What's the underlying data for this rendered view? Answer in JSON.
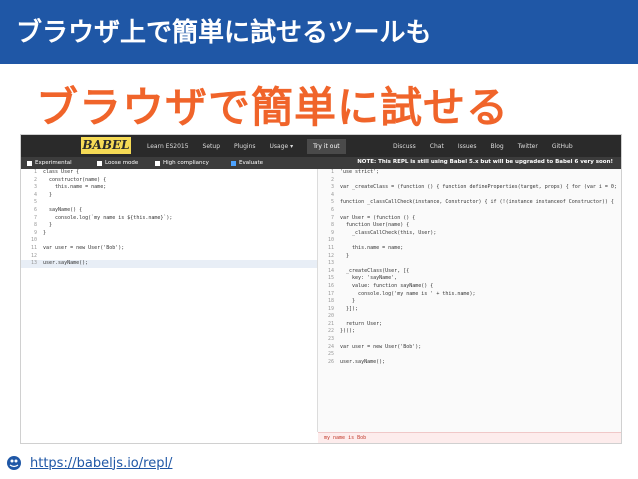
{
  "slide": {
    "title": "ブラウザ上で簡単に試せるツールも",
    "subtitle": "ブラウザで簡単に試せる",
    "link": "https://babeljs.io/repl/"
  },
  "colors": {
    "header_bg": "#1f57a6",
    "subtitle": "#f0642a",
    "babel_yellow": "#f5da55",
    "nav_dark": "#2a2a2a"
  },
  "babel": {
    "logo": "BABEL",
    "nav_left": [
      "Learn ES2015",
      "Setup",
      "Plugins",
      "Usage ▾",
      "Try it out"
    ],
    "nav_right": [
      "Discuss",
      "Chat",
      "Issues",
      "Blog",
      "Twitter",
      "GitHub"
    ],
    "options": [
      {
        "label": "Experimental",
        "checked": false
      },
      {
        "label": "Loose mode",
        "checked": false
      },
      {
        "label": "High compliancy",
        "checked": false
      },
      {
        "label": "Evaluate",
        "checked": true
      }
    ],
    "note": "NOTE: This REPL is still using Babel 5.x but will be upgraded to Babel 6 very soon!"
  },
  "editor": {
    "input": [
      {
        "n": "1",
        "code": "class User {"
      },
      {
        "n": "2",
        "code": "  constructor(name) {"
      },
      {
        "n": "3",
        "code": "    this.name = name;"
      },
      {
        "n": "4",
        "code": "  }"
      },
      {
        "n": "5",
        "code": ""
      },
      {
        "n": "6",
        "code": "  sayName() {"
      },
      {
        "n": "7",
        "code": "    console.log(`my name is ${this.name}`);"
      },
      {
        "n": "8",
        "code": "  }"
      },
      {
        "n": "9",
        "code": "}"
      },
      {
        "n": "10",
        "code": ""
      },
      {
        "n": "11",
        "code": "var user = new User('Bob');"
      },
      {
        "n": "12",
        "code": ""
      },
      {
        "n": "13",
        "code": "user.sayName();"
      }
    ],
    "output": [
      {
        "n": "1",
        "code": "'use strict';"
      },
      {
        "n": "2",
        "code": ""
      },
      {
        "n": "3",
        "code": "var _createClass = (function () { function defineProperties(target, props) { for (var i = 0;"
      },
      {
        "n": "4",
        "code": ""
      },
      {
        "n": "5",
        "code": "function _classCallCheck(instance, Constructor) { if (!(instance instanceof Constructor)) {"
      },
      {
        "n": "6",
        "code": ""
      },
      {
        "n": "7",
        "code": "var User = (function () {"
      },
      {
        "n": "8",
        "code": "  function User(name) {"
      },
      {
        "n": "9",
        "code": "    _classCallCheck(this, User);"
      },
      {
        "n": "10",
        "code": ""
      },
      {
        "n": "11",
        "code": "    this.name = name;"
      },
      {
        "n": "12",
        "code": "  }"
      },
      {
        "n": "13",
        "code": ""
      },
      {
        "n": "14",
        "code": "  _createClass(User, [{"
      },
      {
        "n": "15",
        "code": "    key: 'sayName',"
      },
      {
        "n": "16",
        "code": "    value: function sayName() {"
      },
      {
        "n": "17",
        "code": "      console.log('my name is ' + this.name);"
      },
      {
        "n": "18",
        "code": "    }"
      },
      {
        "n": "19",
        "code": "  }]);"
      },
      {
        "n": "20",
        "code": ""
      },
      {
        "n": "21",
        "code": "  return User;"
      },
      {
        "n": "22",
        "code": "})();"
      },
      {
        "n": "23",
        "code": ""
      },
      {
        "n": "24",
        "code": "var user = new User('Bob');"
      },
      {
        "n": "25",
        "code": ""
      },
      {
        "n": "26",
        "code": "user.sayName();"
      }
    ],
    "console_output": "my name is Bob"
  }
}
